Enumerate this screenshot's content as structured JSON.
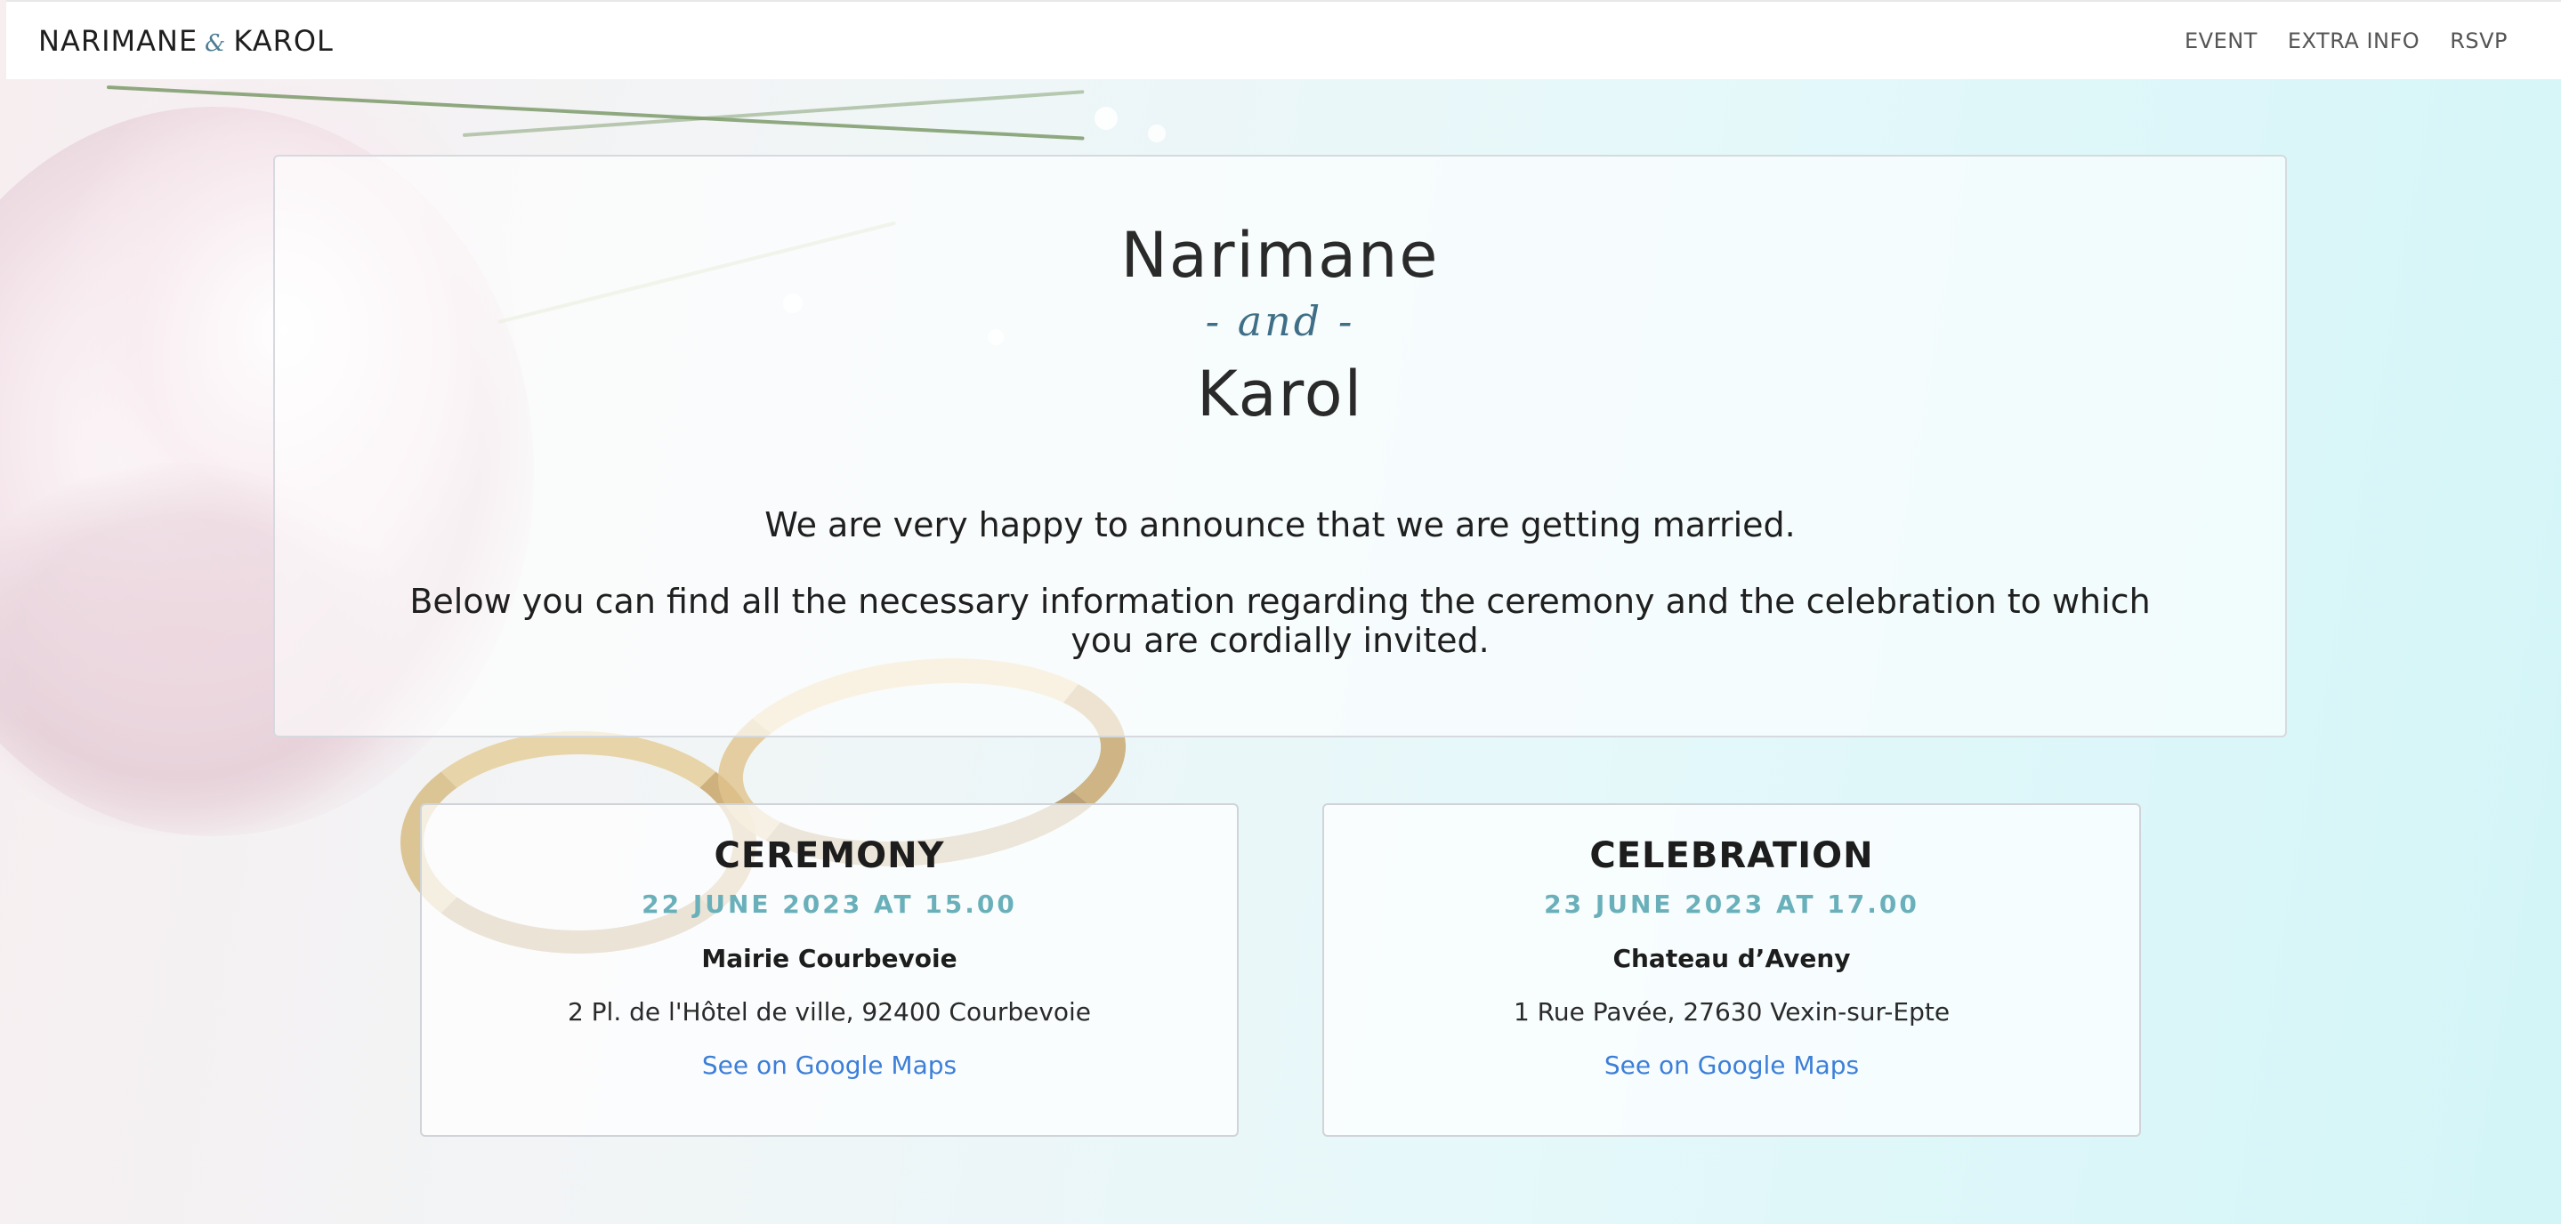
{
  "brand": {
    "first": "NARIMANE",
    "amp": "&",
    "second": "KAROL"
  },
  "nav": {
    "items": [
      "EVENT",
      "EXTRA INFO",
      "RSVP"
    ]
  },
  "hero": {
    "name1": "Narimane",
    "and": "- and -",
    "name2": "Karol",
    "intro1": "We are very happy to announce that we are getting married.",
    "intro2": "Below you can find all the necessary information regarding the ceremony and the celebration to which you are cordially invited."
  },
  "events": [
    {
      "title": "CEREMONY",
      "date": "22 JUNE 2023 AT 15.00",
      "venue": "Mairie Courbevoie",
      "address": "2 Pl. de l'Hôtel de ville, 92400 Courbevoie",
      "link": "See on Google Maps"
    },
    {
      "title": "CELEBRATION",
      "date": "23 JUNE 2023 AT 17.00",
      "venue": "Chateau d’Aveny",
      "address": "1 Rue Pavée, 27630 Vexin-sur-Epte",
      "link": "See on Google Maps"
    }
  ],
  "colors": {
    "accent_teal": "#6ab0ba",
    "and_color": "#3f6f86",
    "link_blue": "#3d7fd8"
  }
}
